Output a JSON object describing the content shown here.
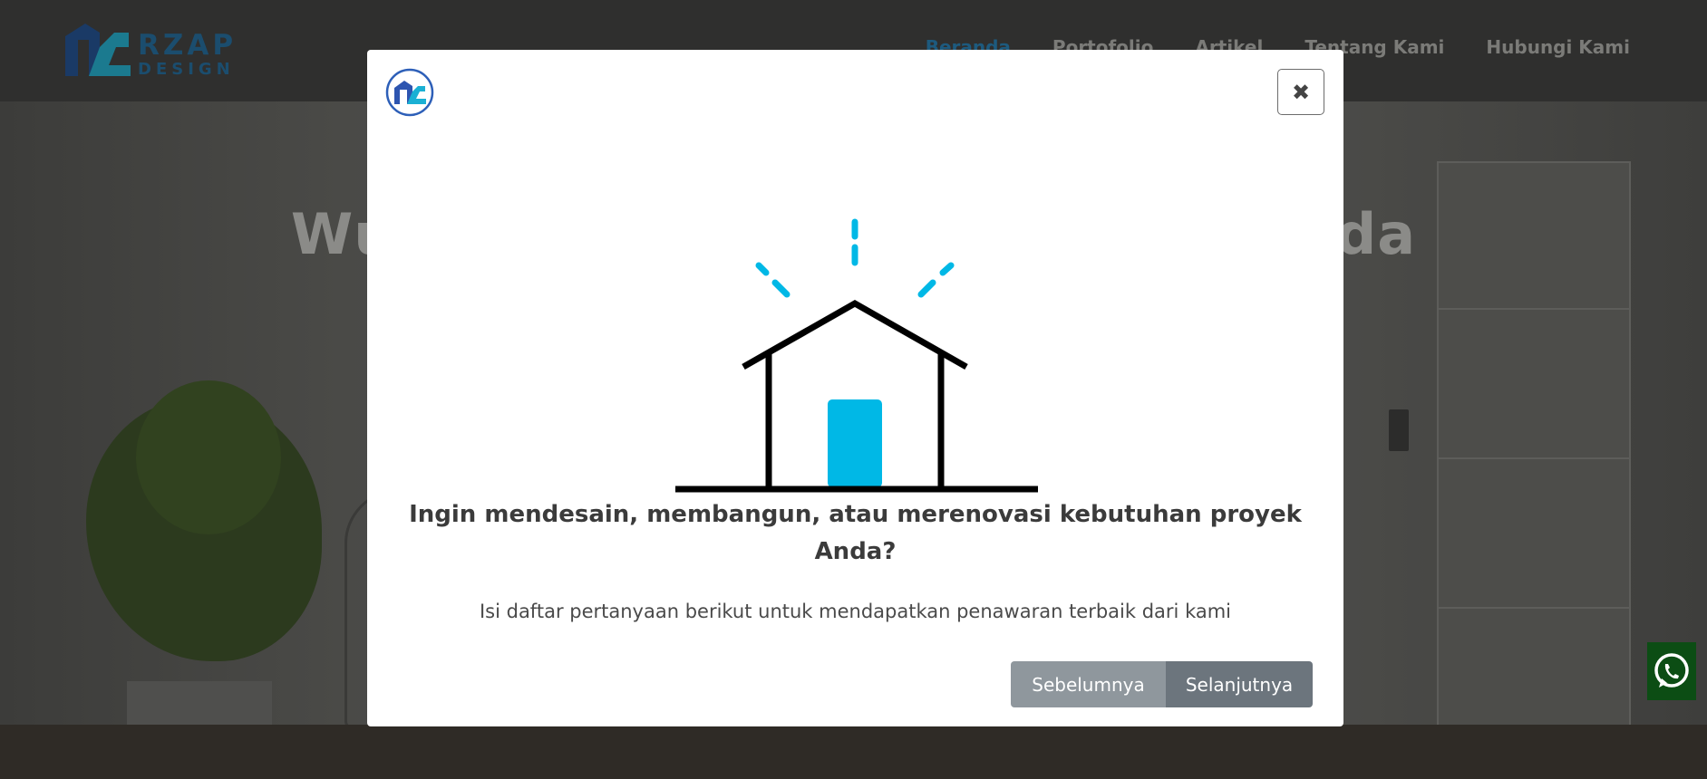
{
  "header": {
    "logo_word": "RZAP",
    "logo_sub": "DESIGN",
    "nav": [
      {
        "label": "Beranda",
        "active": true
      },
      {
        "label": "Portofolio"
      },
      {
        "label": "Artikel"
      },
      {
        "label": "Tentang Kami"
      },
      {
        "label": "Hubungi Kami"
      }
    ]
  },
  "hero": {
    "title_visible": "Wuj                                           nda"
  },
  "modal": {
    "close_icon": "close-icon",
    "heading": "Ingin mendesain, membangun, atau merenovasi kebutuhan proyek Anda?",
    "description": "Isi daftar pertanyaan berikut untuk mendapatkan penawaran terbaik dari kami",
    "prev_label": "Sebelumnya",
    "next_label": "Selanjutnya"
  },
  "colors": {
    "accent": "#00b8e6",
    "button_prev": "#8f979d",
    "button_next": "#6c757d",
    "whatsapp": "#0c4d14"
  }
}
